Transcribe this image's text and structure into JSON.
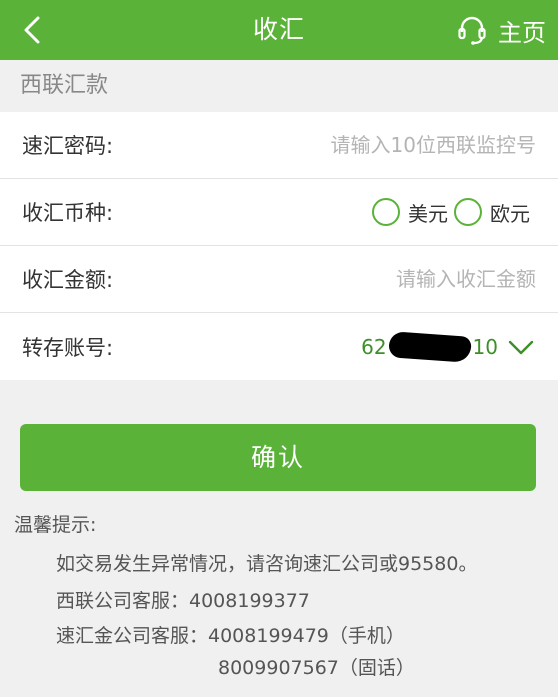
{
  "header": {
    "title": "收汇",
    "home_label": "主页",
    "back_icon": "chevron-left-icon",
    "service_icon": "headset-icon"
  },
  "section_label": "西联汇款",
  "form": {
    "code": {
      "label": "速汇密码:",
      "placeholder": "请输入10位西联监控号"
    },
    "currency": {
      "label": "收汇币种:",
      "options": [
        "美元",
        "欧元"
      ]
    },
    "amount": {
      "label": "收汇金额:",
      "placeholder": "请输入收汇金额"
    },
    "account": {
      "label": "转存账号:",
      "prefix": "62",
      "suffix": "10"
    }
  },
  "confirm_label": "确认",
  "tips": {
    "heading": "温馨提示:",
    "line1": "如交易发生异常情况，请咨询速汇公司或95580。",
    "line2": "西联公司客服：4008199377",
    "line3": "速汇金公司客服：4008199479（手机）",
    "line4": "8009907567（固话）"
  },
  "colors": {
    "brand": "#5ab238",
    "account_text": "#3d8f2a"
  }
}
